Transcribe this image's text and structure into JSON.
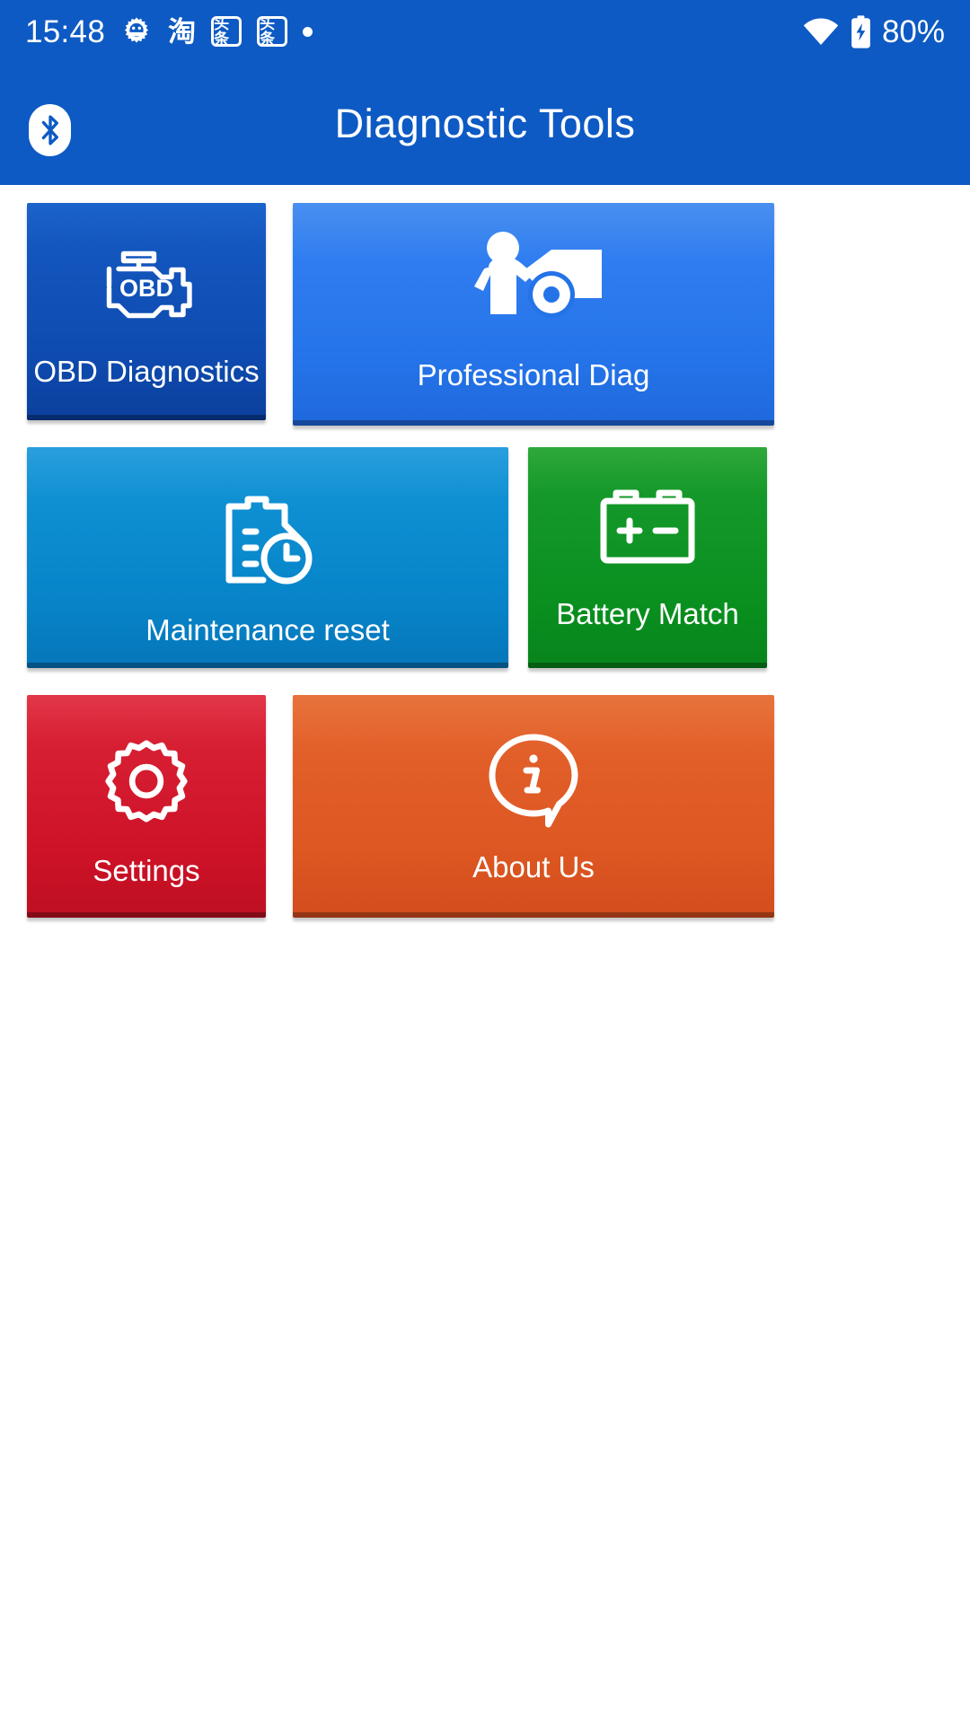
{
  "status_bar": {
    "time": "15:48",
    "battery_percent": "80%",
    "icons": [
      {
        "name": "gear-app-icon",
        "glyph": "gear"
      },
      {
        "name": "taobao-app-icon",
        "glyph": "淘"
      },
      {
        "name": "toutiao-app-icon-1",
        "glyph": "头条"
      },
      {
        "name": "toutiao-app-icon-2",
        "glyph": "头条"
      },
      {
        "name": "notification-dot-icon",
        "glyph": "•"
      },
      {
        "name": "wifi-icon",
        "glyph": "wifi"
      },
      {
        "name": "battery-charging-icon",
        "glyph": "battery"
      }
    ],
    "background_color": "#0D5AC4",
    "foreground_color": "#FFFFFF"
  },
  "app_bar": {
    "title": "Diagnostic Tools",
    "bluetooth_icon": "bluetooth-icon",
    "background_color": "#0D5AC4",
    "title_color": "#FFFFFF"
  },
  "tiles": [
    {
      "id": "obd-diagnostics",
      "label": "OBD Diagnostics",
      "icon": "obd-engine-icon",
      "color": "#0E4BB0",
      "size": "small"
    },
    {
      "id": "professional-diag",
      "label": "Professional Diag",
      "icon": "mechanic-car-icon",
      "color": "#2473E8",
      "size": "large"
    },
    {
      "id": "maintenance-reset",
      "label": "Maintenance reset",
      "icon": "document-clock-icon",
      "color": "#0784C9",
      "size": "large"
    },
    {
      "id": "battery-match",
      "label": "Battery Match",
      "icon": "car-battery-icon",
      "color": "#09901F",
      "size": "small"
    },
    {
      "id": "settings",
      "label": "Settings",
      "icon": "gear-icon",
      "color": "#CE1227",
      "size": "small"
    },
    {
      "id": "about-us",
      "label": "About Us",
      "icon": "info-speech-bubble-icon",
      "color": "#DD5722",
      "size": "large"
    }
  ]
}
